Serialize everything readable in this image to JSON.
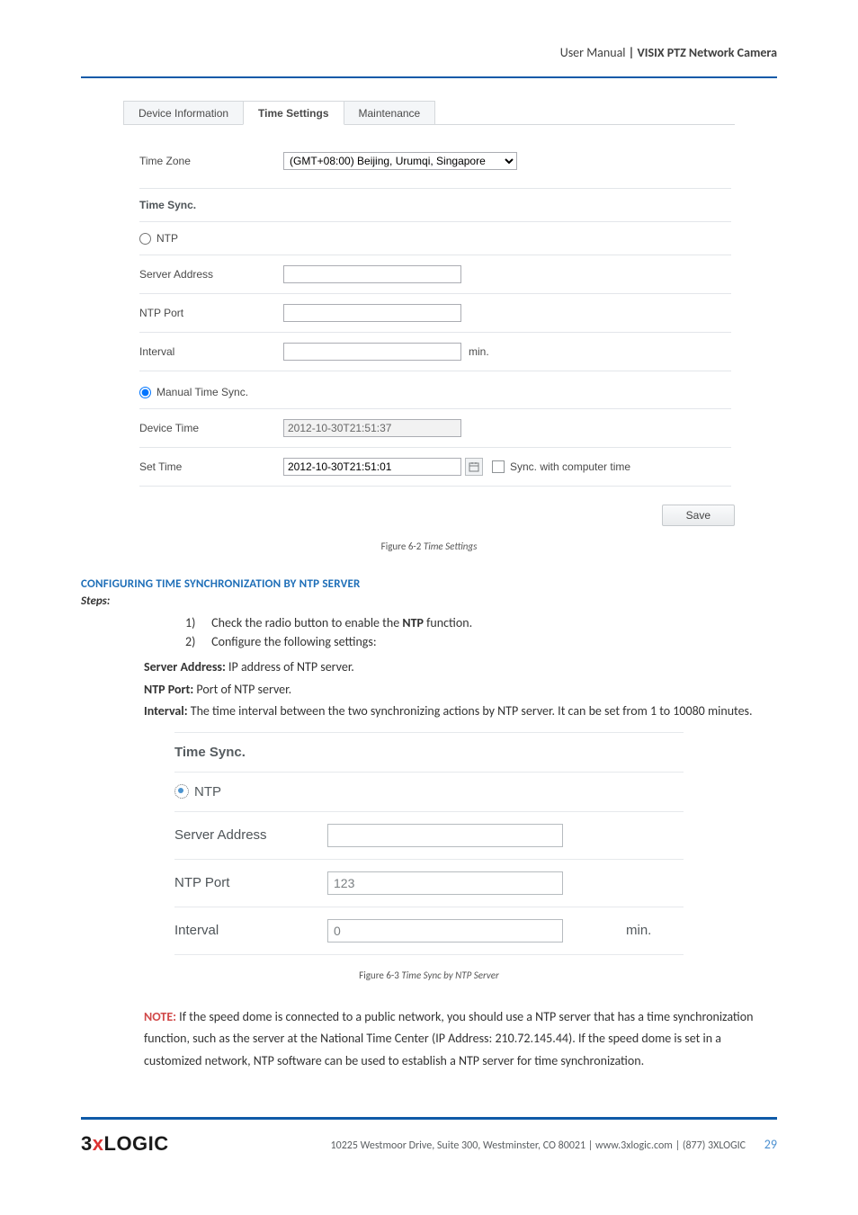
{
  "header": {
    "prefix": "User Manual ",
    "title": "| VISIX PTZ Network Camera"
  },
  "screenshot1": {
    "tabs": [
      "Device Information",
      "Time Settings",
      "Maintenance"
    ],
    "active_tab_index": 1,
    "time_zone": {
      "label": "Time Zone",
      "value": "(GMT+08:00) Beijing, Urumqi, Singapore"
    },
    "group_title": "Time Sync.",
    "ntp": {
      "radio_label": "NTP",
      "server_address_label": "Server Address",
      "server_address_value": "",
      "port_label": "NTP Port",
      "port_value": "",
      "interval_label": "Interval",
      "interval_value": "",
      "interval_unit": "min."
    },
    "manual": {
      "radio_label": "Manual Time Sync.",
      "device_time_label": "Device Time",
      "device_time_value": "2012-10-30T21:51:37",
      "set_time_label": "Set Time",
      "set_time_value": "2012-10-30T21:51:01",
      "sync_label": "Sync. with computer time"
    },
    "save_button": "Save"
  },
  "caption1": {
    "label": "Figure 6-2 ",
    "italic": "Time Settings"
  },
  "section1": {
    "heading": "CONFIGURING TIME SYNCHRONIZATION BY NTP SERVER",
    "steps_label": "Steps:",
    "step1": "Check the radio button to enable the NTP function.",
    "step1_num": "1)",
    "step2": "Configure the following settings:",
    "step2_num": "2)",
    "server_address_line": "Server Address: IP address of NTP server.",
    "ntp_port_line": "NTP Port: Port of NTP server.",
    "interval_line": "Interval: The time interval between the two synchronizing actions by NTP server. It can be set from 1 to 10080 minutes."
  },
  "screenshot2": {
    "group_title": "Time Sync.",
    "radio_label": "NTP",
    "server_address_label": "Server Address",
    "server_address_value": "",
    "port_label": "NTP Port",
    "port_value": "123",
    "interval_label": "Interval",
    "interval_value": "0",
    "interval_unit": "min."
  },
  "caption2": {
    "label": "Figure 6-3 ",
    "italic": "Time Sync by NTP Server"
  },
  "note": {
    "prefix": "NOTE:",
    "body": " If the speed dome is connected to a public network, you should use a NTP server that has a time synchronization function, such as the server at the National Time Center (IP Address: 210.72.145.44). If the speed dome is set in a customized network, NTP software can be used to establish a NTP server for time synchronization."
  },
  "footer": {
    "brand_pre": "3",
    "brand_x": "x",
    "brand_post": "LOGIC",
    "line": "10225 Westmoor Drive, Suite 300, Westminster, CO 80021 | www.3xlogic.com | (877) 3XLOGIC",
    "page": "29"
  }
}
